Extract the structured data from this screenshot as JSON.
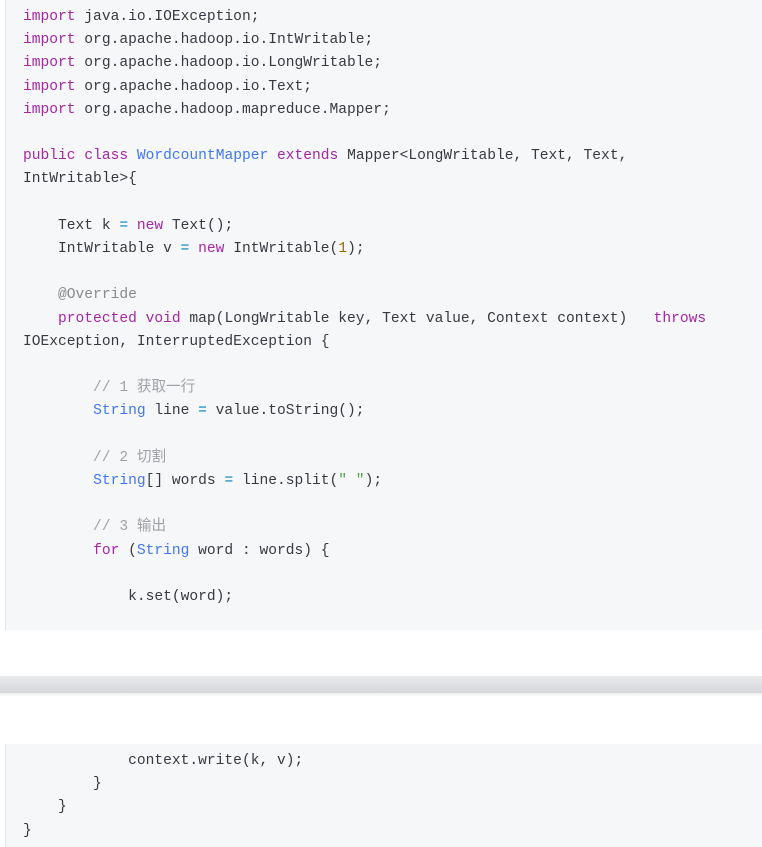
{
  "code_top": [
    [
      [
        "kw",
        "import"
      ],
      [
        "t",
        " java.io.IOException;"
      ]
    ],
    [
      [
        "kw",
        "import"
      ],
      [
        "t",
        " org.apache.hadoop.io.IntWritable;"
      ]
    ],
    [
      [
        "kw",
        "import"
      ],
      [
        "t",
        " org.apache.hadoop.io.LongWritable;"
      ]
    ],
    [
      [
        "kw",
        "import"
      ],
      [
        "t",
        " org.apache.hadoop.io.Text;"
      ]
    ],
    [
      [
        "kw",
        "import"
      ],
      [
        "t",
        " org.apache.hadoop.mapreduce.Mapper;"
      ]
    ],
    [],
    [
      [
        "kw",
        "public"
      ],
      [
        "t",
        " "
      ],
      [
        "kw",
        "class"
      ],
      [
        "t",
        " "
      ],
      [
        "cls",
        "WordcountMapper"
      ],
      [
        "t",
        " "
      ],
      [
        "kw",
        "extends"
      ],
      [
        "t",
        " Mapper<LongWritable, Text, Text,"
      ]
    ],
    [
      [
        "t",
        "IntWritable>{"
      ]
    ],
    [],
    [
      [
        "t",
        "    Text k "
      ],
      [
        "op",
        "="
      ],
      [
        "t",
        " "
      ],
      [
        "kw",
        "new"
      ],
      [
        "t",
        " Text();"
      ]
    ],
    [
      [
        "t",
        "    IntWritable v "
      ],
      [
        "op",
        "="
      ],
      [
        "t",
        " "
      ],
      [
        "kw",
        "new"
      ],
      [
        "t",
        " IntWritable("
      ],
      [
        "num",
        "1"
      ],
      [
        "t",
        ");"
      ]
    ],
    [],
    [
      [
        "ann",
        "    @Override"
      ]
    ],
    [
      [
        "t",
        "    "
      ],
      [
        "kw",
        "protected"
      ],
      [
        "t",
        " "
      ],
      [
        "kw",
        "void"
      ],
      [
        "t",
        " map(LongWritable key, Text value, Context context)   "
      ],
      [
        "kw",
        "throws"
      ]
    ],
    [
      [
        "t",
        "IOException, InterruptedException {"
      ]
    ],
    [],
    [
      [
        "cm",
        "        // 1 获取一行"
      ]
    ],
    [
      [
        "t",
        "        "
      ],
      [
        "cls",
        "String"
      ],
      [
        "t",
        " line "
      ],
      [
        "op",
        "="
      ],
      [
        "t",
        " value.toString();"
      ]
    ],
    [],
    [
      [
        "cm",
        "        // 2 切割"
      ]
    ],
    [
      [
        "t",
        "        "
      ],
      [
        "cls",
        "String"
      ],
      [
        "t",
        "[] words "
      ],
      [
        "op",
        "="
      ],
      [
        "t",
        " line.split("
      ],
      [
        "str",
        "\" \""
      ],
      [
        "t",
        ");"
      ]
    ],
    [],
    [
      [
        "cm",
        "        // 3 输出"
      ]
    ],
    [
      [
        "t",
        "        "
      ],
      [
        "kw",
        "for"
      ],
      [
        "t",
        " ("
      ],
      [
        "cls",
        "String"
      ],
      [
        "t",
        " word : words) {"
      ]
    ],
    [],
    [
      [
        "t",
        "            k.set(word);"
      ]
    ]
  ],
  "code_bottom": [
    [
      [
        "t",
        "            context.write(k, v);"
      ]
    ],
    [
      [
        "t",
        "        }"
      ]
    ],
    [
      [
        "t",
        "    }"
      ]
    ],
    [
      [
        "t",
        "}"
      ]
    ]
  ]
}
